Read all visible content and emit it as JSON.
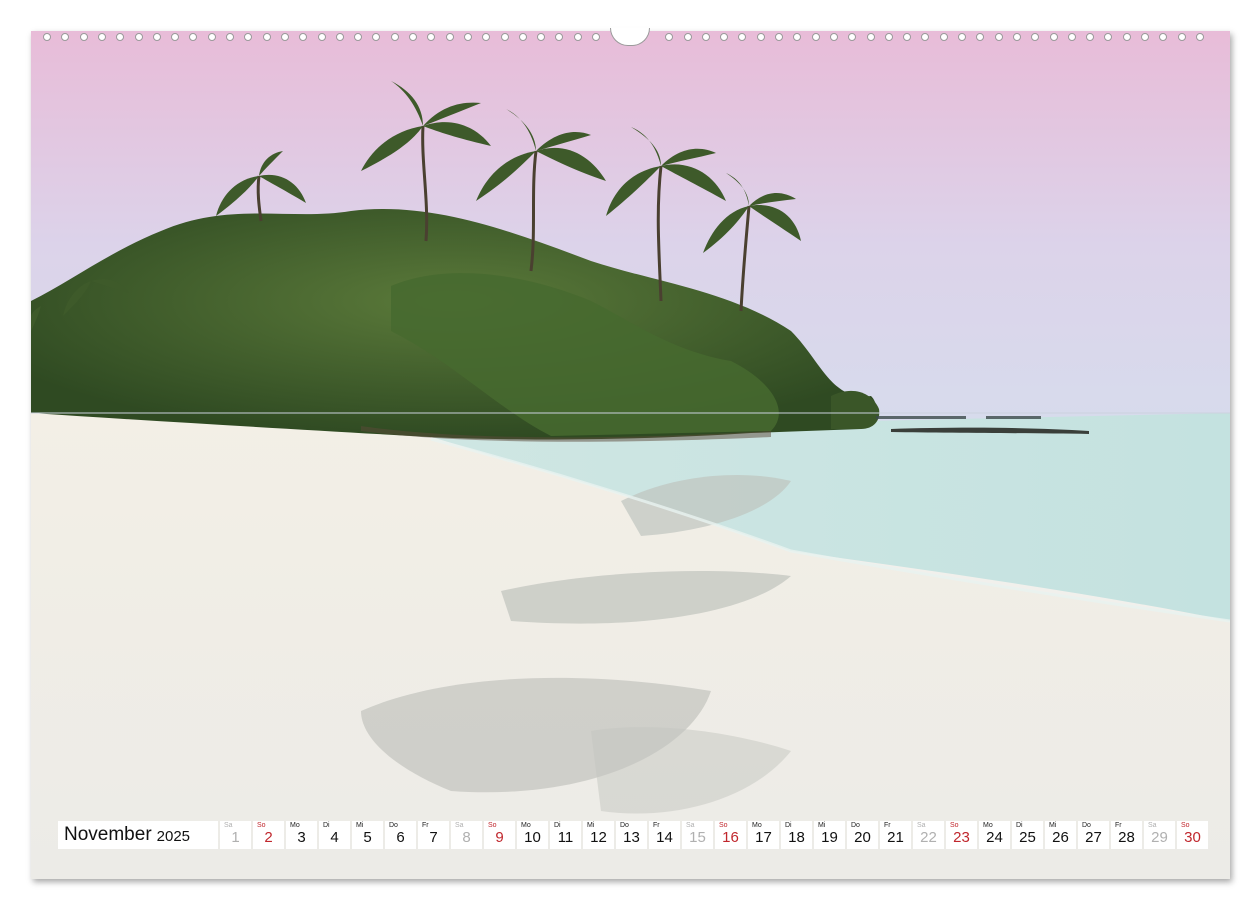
{
  "calendar": {
    "month": "November",
    "year": "2025",
    "days": [
      {
        "wd": "Sa",
        "n": "1",
        "type": "sat"
      },
      {
        "wd": "So",
        "n": "2",
        "type": "sun"
      },
      {
        "wd": "Mo",
        "n": "3",
        "type": "day"
      },
      {
        "wd": "Di",
        "n": "4",
        "type": "day"
      },
      {
        "wd": "Mi",
        "n": "5",
        "type": "day"
      },
      {
        "wd": "Do",
        "n": "6",
        "type": "day"
      },
      {
        "wd": "Fr",
        "n": "7",
        "type": "day"
      },
      {
        "wd": "Sa",
        "n": "8",
        "type": "sat"
      },
      {
        "wd": "So",
        "n": "9",
        "type": "sun"
      },
      {
        "wd": "Mo",
        "n": "10",
        "type": "day"
      },
      {
        "wd": "Di",
        "n": "11",
        "type": "day"
      },
      {
        "wd": "Mi",
        "n": "12",
        "type": "day"
      },
      {
        "wd": "Do",
        "n": "13",
        "type": "day"
      },
      {
        "wd": "Fr",
        "n": "14",
        "type": "day"
      },
      {
        "wd": "Sa",
        "n": "15",
        "type": "sat"
      },
      {
        "wd": "So",
        "n": "16",
        "type": "sun"
      },
      {
        "wd": "Mo",
        "n": "17",
        "type": "day"
      },
      {
        "wd": "Di",
        "n": "18",
        "type": "day"
      },
      {
        "wd": "Mi",
        "n": "19",
        "type": "day"
      },
      {
        "wd": "Do",
        "n": "20",
        "type": "day"
      },
      {
        "wd": "Fr",
        "n": "21",
        "type": "day"
      },
      {
        "wd": "Sa",
        "n": "22",
        "type": "sat"
      },
      {
        "wd": "So",
        "n": "23",
        "type": "sun"
      },
      {
        "wd": "Mo",
        "n": "24",
        "type": "day"
      },
      {
        "wd": "Di",
        "n": "25",
        "type": "day"
      },
      {
        "wd": "Mi",
        "n": "26",
        "type": "day"
      },
      {
        "wd": "Do",
        "n": "27",
        "type": "day"
      },
      {
        "wd": "Fr",
        "n": "28",
        "type": "day"
      },
      {
        "wd": "Sa",
        "n": "29",
        "type": "sat"
      },
      {
        "wd": "So",
        "n": "30",
        "type": "sun"
      }
    ]
  },
  "colors": {
    "sunday": "#c0262c",
    "saturday": "#b0b0b0",
    "weekday": "#111111",
    "sky_top": "#e8bcd8",
    "sky_horizon": "#dcd6ea",
    "sea": "#c9e4e1",
    "sand": "#f1efe9",
    "foliage": "#3f5a2c"
  },
  "binding": {
    "icon": "wire-binding-icon",
    "hanger_icon": "hanger-notch-icon"
  },
  "photo": {
    "icon": "tropical-beach-photo"
  }
}
